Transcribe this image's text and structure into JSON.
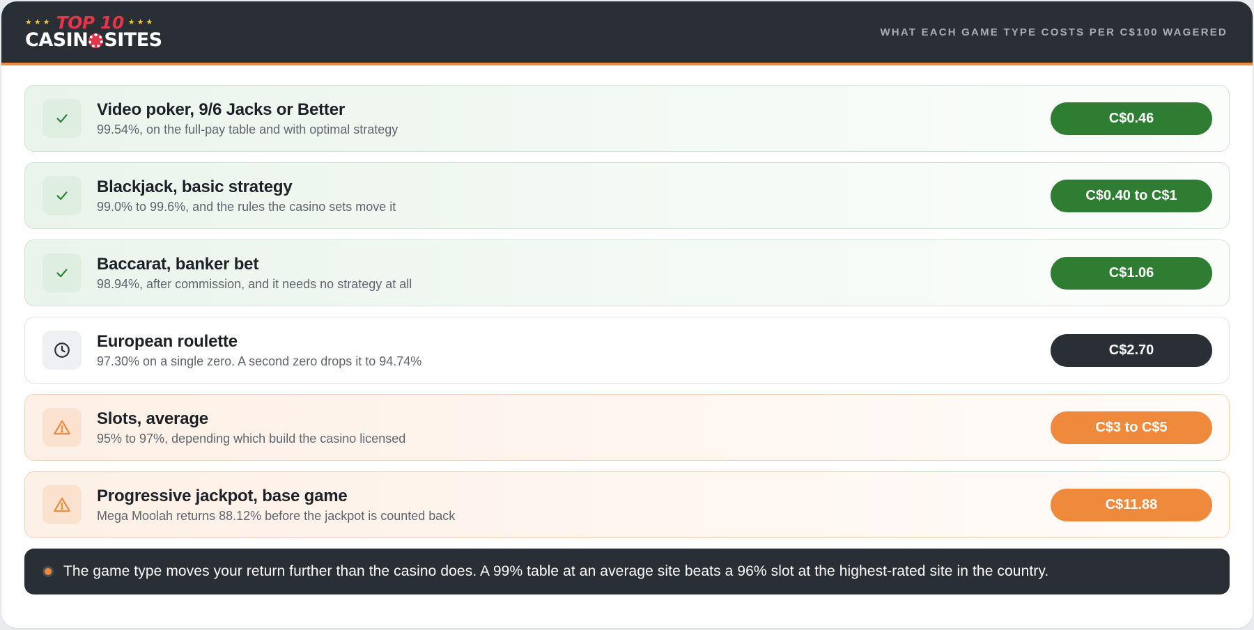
{
  "brand": {
    "logo_top": "TOP 10",
    "logo_left": "CASIN",
    "logo_right": "SITES"
  },
  "header": {
    "caption": "WHAT EACH GAME TYPE COSTS PER C$100 WAGERED"
  },
  "colors": {
    "good": "#2e7d32",
    "neutral": "#2a2f36",
    "warn": "#ef8a3d",
    "accent": "#ef8a3d"
  },
  "games": [
    {
      "title": "Video poker, 9/6 Jacks or Better",
      "detail": "99.54%, on the full-pay table and with optimal strategy",
      "cost": "C$0.46",
      "status": "good",
      "icon": "check-icon"
    },
    {
      "title": "Blackjack, basic strategy",
      "detail": "99.0% to 99.6%, and the rules the casino sets move it",
      "cost": "C$0.40 to C$1",
      "status": "good",
      "icon": "check-icon"
    },
    {
      "title": "Baccarat, banker bet",
      "detail": "98.94%, after commission, and it needs no strategy at all",
      "cost": "C$1.06",
      "status": "good",
      "icon": "check-icon"
    },
    {
      "title": "European roulette",
      "detail": "97.30% on a single zero. A second zero drops it to 94.74%",
      "cost": "C$2.70",
      "status": "neutral",
      "icon": "clock-icon"
    },
    {
      "title": "Slots, average",
      "detail": "95% to 97%, depending which build the casino licensed",
      "cost": "C$3 to C$5",
      "status": "warn",
      "icon": "warning-icon"
    },
    {
      "title": "Progressive jackpot, base game",
      "detail": "Mega Moolah returns 88.12% before the jackpot is counted back",
      "cost": "C$11.88",
      "status": "warn",
      "icon": "warning-icon"
    }
  ],
  "note": {
    "text": "The game type moves your return further than the casino does. A 99% table at an average site beats a 96% slot at the highest-rated site in the country."
  }
}
